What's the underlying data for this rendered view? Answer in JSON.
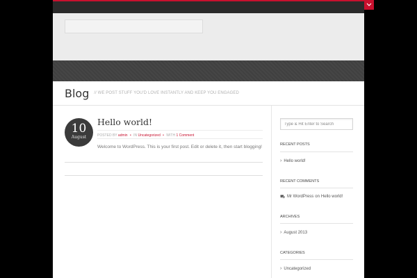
{
  "colors": {
    "accent": "#c8102e",
    "nav": "#424242",
    "background": "#000000"
  },
  "header": {
    "toggle_icon": "chevron-down-icon"
  },
  "titlebar": {
    "title": "Blog",
    "tagline": "// WE POST STUFF YOU'D LOVE INSTANTLY AND KEEP YOU ENGAGED"
  },
  "post": {
    "date_day": "10",
    "date_month": "August",
    "title": "Hello world!",
    "meta_posted_by": "POSTED BY",
    "meta_author": "admin",
    "meta_in": "IN",
    "meta_category": "Uncategorized",
    "meta_with": "WITH",
    "meta_comments": "1 Comment",
    "excerpt": "Welcome to WordPress. This is your first post. Edit or delete it, then start blogging!"
  },
  "sidebar": {
    "search_placeholder": "Type & Hit Enter to Search",
    "recent_posts": {
      "title": "RECENT POSTS",
      "items": [
        "Hello world!"
      ]
    },
    "recent_comments": {
      "title": "RECENT COMMENTS",
      "author": "Mr WordPress",
      "on": "on",
      "post": "Hello world!"
    },
    "archives": {
      "title": "ARCHIVES",
      "items": [
        "August 2013"
      ]
    },
    "categories": {
      "title": "CATEGORIES",
      "items": [
        "Uncategorized"
      ]
    }
  }
}
